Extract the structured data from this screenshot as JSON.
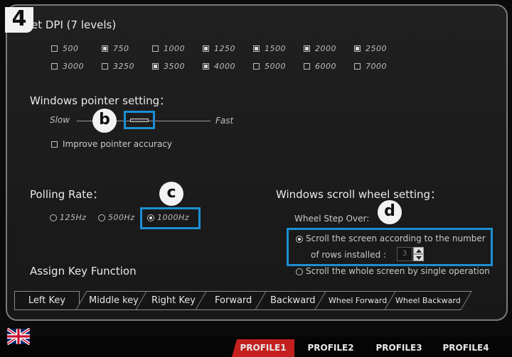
{
  "step_badge": "4",
  "dpi": {
    "title": "et DPI (7 levels)",
    "options": [
      {
        "value": "500",
        "checked": false
      },
      {
        "value": "750",
        "checked": true
      },
      {
        "value": "1000",
        "checked": false
      },
      {
        "value": "1250",
        "checked": true
      },
      {
        "value": "1500",
        "checked": true
      },
      {
        "value": "2000",
        "checked": true
      },
      {
        "value": "2500",
        "checked": true
      },
      {
        "value": "3000",
        "checked": false
      },
      {
        "value": "3250",
        "checked": false
      },
      {
        "value": "3500",
        "checked": true
      },
      {
        "value": "4000",
        "checked": true
      },
      {
        "value": "5000",
        "checked": false
      },
      {
        "value": "6000",
        "checked": false
      },
      {
        "value": "7000",
        "checked": false
      }
    ]
  },
  "pointer": {
    "heading": "Windows pointer setting：",
    "slow_label": "Slow",
    "fast_label": "Fast",
    "improve_label": "Improve pointer accuracy",
    "improve_checked": false,
    "marker": "b"
  },
  "polling": {
    "heading": "Polling Rate：",
    "marker": "c",
    "options": [
      {
        "label": "125Hz",
        "selected": false
      },
      {
        "label": "500Hz",
        "selected": false
      },
      {
        "label": "1000Hz",
        "selected": true
      }
    ]
  },
  "scroll": {
    "heading": "Windows scroll wheel setting：",
    "step_over_label": "Wheel Step Over:",
    "marker": "d",
    "option1_line1": "Scroll the screen according to the  number",
    "option1_line2": "of rows installed :",
    "rows_value": "3",
    "option2": "Scroll the whole screen by single operation",
    "option1_selected": true
  },
  "assign": {
    "heading": "Assign Key Function",
    "tabs": [
      "Left Key",
      "Middle key",
      "Right Key",
      "Forward",
      "Backward",
      "Wheel Forward",
      "Wheel Backward"
    ]
  },
  "profiles": [
    {
      "label": "PROFILE1",
      "active": true
    },
    {
      "label": "PROFILE2",
      "active": false
    },
    {
      "label": "PROFILE3",
      "active": false
    },
    {
      "label": "PROFILE4",
      "active": false
    }
  ],
  "colors": {
    "accent": "#1c8fd3",
    "profile_active": "#c3201f"
  }
}
